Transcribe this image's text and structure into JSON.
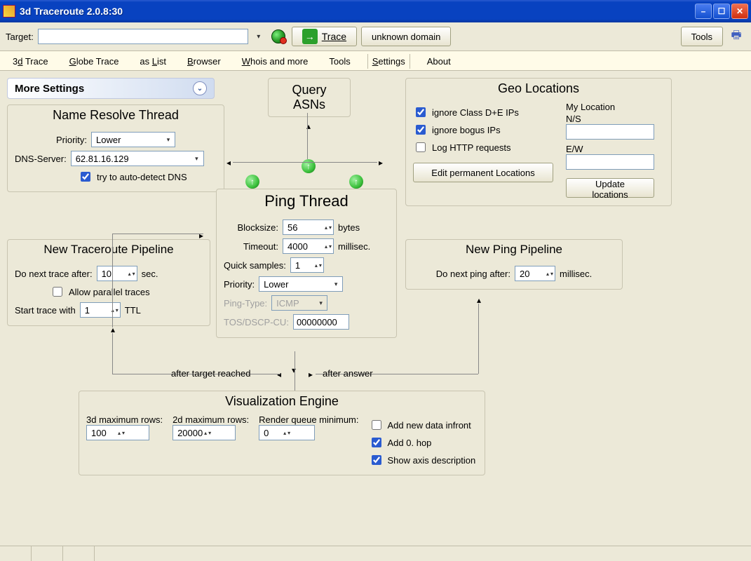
{
  "window": {
    "title": "3d Traceroute 2.0.8:30"
  },
  "toolbar": {
    "target_label": "Target:",
    "target_value": "",
    "trace_label": "Trace",
    "unknown_domain": "unknown domain",
    "tools_label": "Tools"
  },
  "tabs": {
    "trace3d": "3d Trace",
    "globe": "Globe Trace",
    "aslist": "as List",
    "browser": "Browser",
    "whois": "Whois and more",
    "tools": "Tools",
    "settings": "Settings",
    "about": "About"
  },
  "section_header": "More Settings",
  "name_resolve": {
    "title": "Name Resolve Thread",
    "priority_label": "Priority:",
    "priority_value": "Lower",
    "dns_label": "DNS-Server:",
    "dns_value": "62.81.16.129",
    "autodetect": "try to auto-detect DNS"
  },
  "query_asn": {
    "line1": "Query",
    "line2": "ASNs"
  },
  "geo": {
    "title": "Geo Locations",
    "ignore_de": "ignore Class D+E IPs",
    "ignore_bogus": "ignore bogus IPs",
    "log_http": "Log HTTP requests",
    "my_loc": "My Location",
    "ns": "N/S",
    "ew": "E/W",
    "ns_value": "",
    "ew_value": "",
    "edit_perm": "Edit permanent Locations",
    "update": "Update locations"
  },
  "trace_pipe": {
    "title": "New Traceroute Pipeline",
    "next_after_label": "Do next trace after:",
    "next_after_value": "10",
    "sec": "sec.",
    "allow_parallel": "Allow parallel traces",
    "start_with_label": "Start trace with",
    "start_with_value": "1",
    "ttl": "TTL"
  },
  "ping_thread": {
    "title": "Ping Thread",
    "blocksize_label": "Blocksize:",
    "blocksize_value": "56",
    "bytes": "bytes",
    "timeout_label": "Timeout:",
    "timeout_value": "4000",
    "millisec": "millisec.",
    "quick_label": "Quick samples:",
    "quick_value": "1",
    "priority_label": "Priority:",
    "priority_value": "Lower",
    "pingtype_label": "Ping-Type:",
    "pingtype_value": "ICMP",
    "tos_label": "TOS/DSCP-CU:",
    "tos_value": "00000000"
  },
  "ping_pipe": {
    "title": "New Ping Pipeline",
    "next_after_label": "Do next ping after:",
    "next_after_value": "20",
    "millisec": "millisec."
  },
  "viz": {
    "title": "Visualization Engine",
    "max3d_label": "3d maximum rows:",
    "max3d_value": "100",
    "max2d_label": "2d maximum rows:",
    "max2d_value": "20000",
    "render_label": "Render queue minimum:",
    "render_value": "0",
    "add_front": "Add new data infront",
    "add_0hop": "Add 0. hop",
    "show_axis": "Show axis description"
  },
  "flow": {
    "after_target": "after target reached",
    "after_answer": "after answer"
  }
}
